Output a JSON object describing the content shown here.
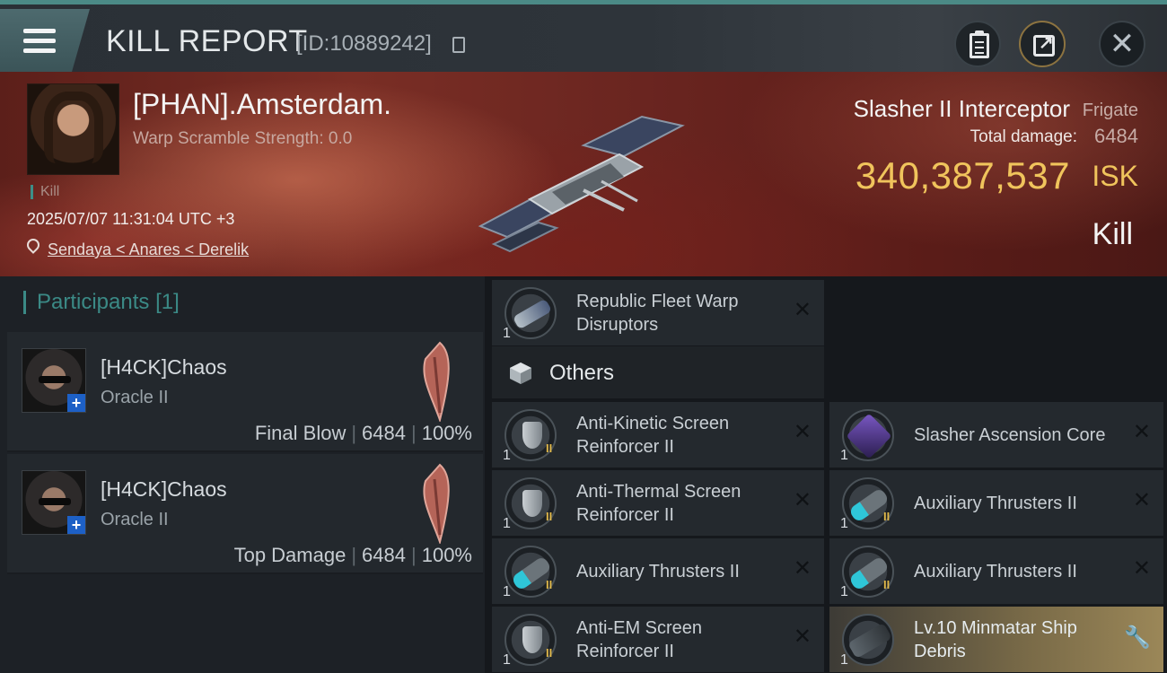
{
  "header": {
    "title": "KILL REPORT",
    "id_label": "[ID:10889242]"
  },
  "victim": {
    "name": "[PHAN].Amsterdam.",
    "warp_scramble": "Warp Scramble Strength: 0.0",
    "kill_tag": "Kill",
    "timestamp": "2025/07/07 11:31:04 UTC +3",
    "location": "Sendaya < Anares < Derelik"
  },
  "ship": {
    "name": "Slasher II Interceptor",
    "class": "Frigate",
    "total_damage_label": "Total damage:",
    "total_damage": "6484",
    "isk_value": "340,387,537",
    "isk_unit": "ISK",
    "result": "Kill"
  },
  "participants": {
    "heading": "Participants",
    "count": "[1]",
    "rows": [
      {
        "name": "[H4CK]Chaos",
        "ship": "Oracle II",
        "role": "Final Blow",
        "damage": "6484",
        "percent": "100%"
      },
      {
        "name": "[H4CK]Chaos",
        "ship": "Oracle II",
        "role": "Top Damage",
        "damage": "6484",
        "percent": "100%"
      }
    ]
  },
  "items": {
    "top": [
      {
        "name": "Republic Fleet Warp Disruptors",
        "qty": "1",
        "icon": "warp-disruptor-icon"
      }
    ],
    "others_label": "Others",
    "others": [
      {
        "name": "Anti-Kinetic Screen Reinforcer II",
        "qty": "1",
        "tier": "II",
        "icon": "screen-reinforcer-icon"
      },
      {
        "name": "Slasher Ascension Core",
        "qty": "1",
        "tier": "",
        "icon": "ascension-core-icon"
      },
      {
        "name": "Anti-Thermal Screen Reinforcer II",
        "qty": "1",
        "tier": "II",
        "icon": "screen-reinforcer-icon"
      },
      {
        "name": "Auxiliary Thrusters II",
        "qty": "1",
        "tier": "II",
        "icon": "thruster-icon"
      },
      {
        "name": "Auxiliary Thrusters II",
        "qty": "1",
        "tier": "II",
        "icon": "thruster-icon"
      },
      {
        "name": "Auxiliary Thrusters II",
        "qty": "1",
        "tier": "II",
        "icon": "thruster-icon"
      },
      {
        "name": "Anti-EM Screen Reinforcer II",
        "qty": "1",
        "tier": "II",
        "icon": "screen-reinforcer-icon"
      },
      {
        "name": "Lv.10 Minmatar Ship Debris",
        "qty": "1",
        "tier": "",
        "icon": "ship-debris-icon"
      }
    ],
    "destroyed_mark": "✕"
  },
  "colors": {
    "accent": "#3b8a86",
    "isk_gold": "#f0c45c",
    "banner_red": "#6a2520"
  }
}
